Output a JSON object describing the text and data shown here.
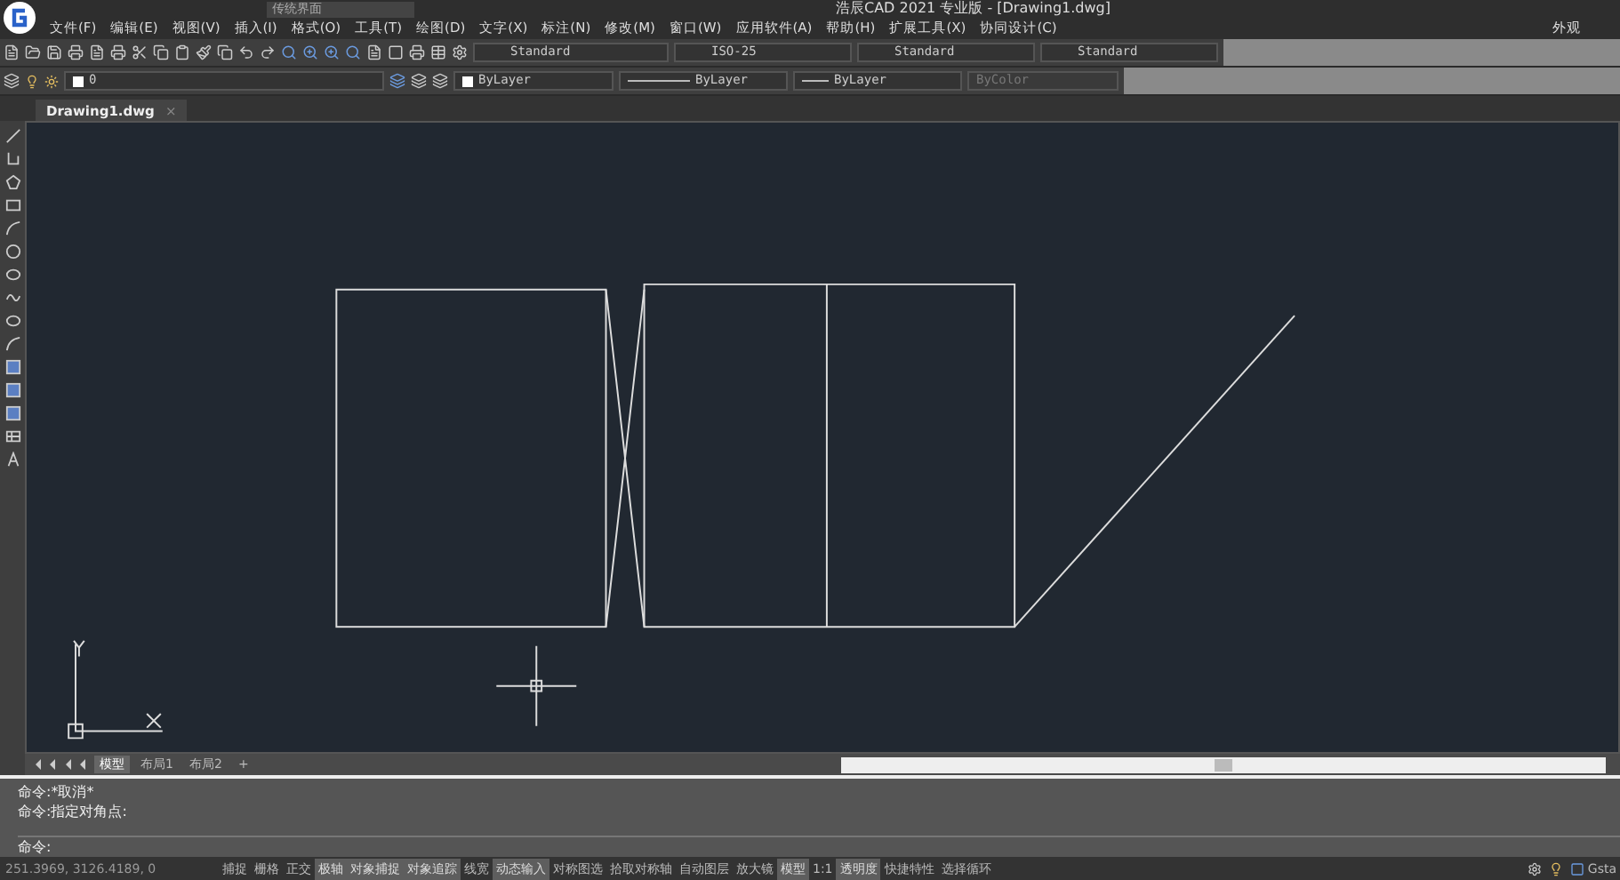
{
  "window": {
    "title": "浩辰CAD 2021 专业版 - [Drawing1.dwg]",
    "workspace": "传统界面"
  },
  "menu": [
    "文件(F)",
    "编辑(E)",
    "视图(V)",
    "插入(I)",
    "格式(O)",
    "工具(T)",
    "绘图(D)",
    "文字(X)",
    "标注(N)",
    "修改(M)",
    "窗口(W)",
    "应用软件(A)",
    "帮助(H)",
    "扩展工具(X)",
    "协同设计(C)"
  ],
  "appearance_menu": "外观",
  "styles": [
    {
      "value": "Standard"
    },
    {
      "value": "ISO-25"
    },
    {
      "value": "Standard"
    },
    {
      "value": "Standard"
    }
  ],
  "layer": {
    "name": "0"
  },
  "properties": [
    {
      "value": "ByLayer",
      "kind": "color"
    },
    {
      "value": "ByLayer",
      "kind": "line"
    },
    {
      "value": "ByLayer",
      "kind": "line"
    },
    {
      "value": "ByColor",
      "kind": "disabled"
    }
  ],
  "document_tabs": [
    {
      "label": "Drawing1.dwg",
      "selected": true,
      "close": "×"
    }
  ],
  "layout_tabs": [
    {
      "label": "模型",
      "selected": true
    },
    {
      "label": "布局1",
      "selected": false
    },
    {
      "label": "布局2",
      "selected": false
    }
  ],
  "layout_add": "+",
  "command_history": [
    "命令:*取消*",
    "命令:指定对角点:"
  ],
  "command_prompt": "命令:",
  "coordinates": "251.3969, 3126.4189, 0",
  "status_toggles": [
    {
      "label": "捕捉",
      "on": false
    },
    {
      "label": "栅格",
      "on": false
    },
    {
      "label": "正交",
      "on": false
    },
    {
      "label": "极轴",
      "on": true
    },
    {
      "label": "对象捕捉",
      "on": true
    },
    {
      "label": "对象追踪",
      "on": true
    },
    {
      "label": "线宽",
      "on": false
    },
    {
      "label": "动态输入",
      "on": true
    },
    {
      "label": "对称图选",
      "on": false
    },
    {
      "label": "拾取对称轴",
      "on": false
    },
    {
      "label": "自动图层",
      "on": false
    },
    {
      "label": "放大镜",
      "on": false
    },
    {
      "label": "模型",
      "on": true
    }
  ],
  "scale": "1:1",
  "status_toggles_2": [
    {
      "label": "透明度",
      "on": true
    },
    {
      "label": "快捷特性",
      "on": false
    },
    {
      "label": "选择循环",
      "on": false
    }
  ],
  "status_right": "Gsta"
}
